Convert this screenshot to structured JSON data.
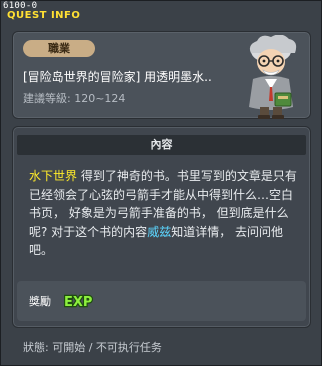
{
  "window": {
    "quest_id": "6100-0",
    "title": "QUEST INFO",
    "close_glyph": "×"
  },
  "header": {
    "job_tag": "職業",
    "quest_name": "[冒险岛世界的冒险家] 用透明墨水..",
    "level_text": "建議等級: 120~124"
  },
  "content": {
    "heading": "內容",
    "description_parts": [
      {
        "text": "水下世界",
        "style": "hl-yellow"
      },
      {
        "text": " 得到了神奇的书。书里写到的文章是只有已经领会了心弦的弓箭手才能从中得到什么…空白书页， 好象是为弓箭手准备的书， 但到底是什么呢? 对于这个书的内容",
        "style": ""
      },
      {
        "text": "威兹",
        "style": "hl-cyan"
      },
      {
        "text": "知道详情， 去问问他吧。",
        "style": ""
      }
    ]
  },
  "reward": {
    "label": "獎勵",
    "exp_text": "EXP",
    "icon": "exp-icon"
  },
  "status": {
    "text": "狀態: 可開始 / 不可执行任务"
  },
  "colors": {
    "title": "#ffe033",
    "highlight_yellow": "#ffeb2a",
    "highlight_cyan": "#5cd6ff",
    "exp_green": "#7ee83a"
  }
}
